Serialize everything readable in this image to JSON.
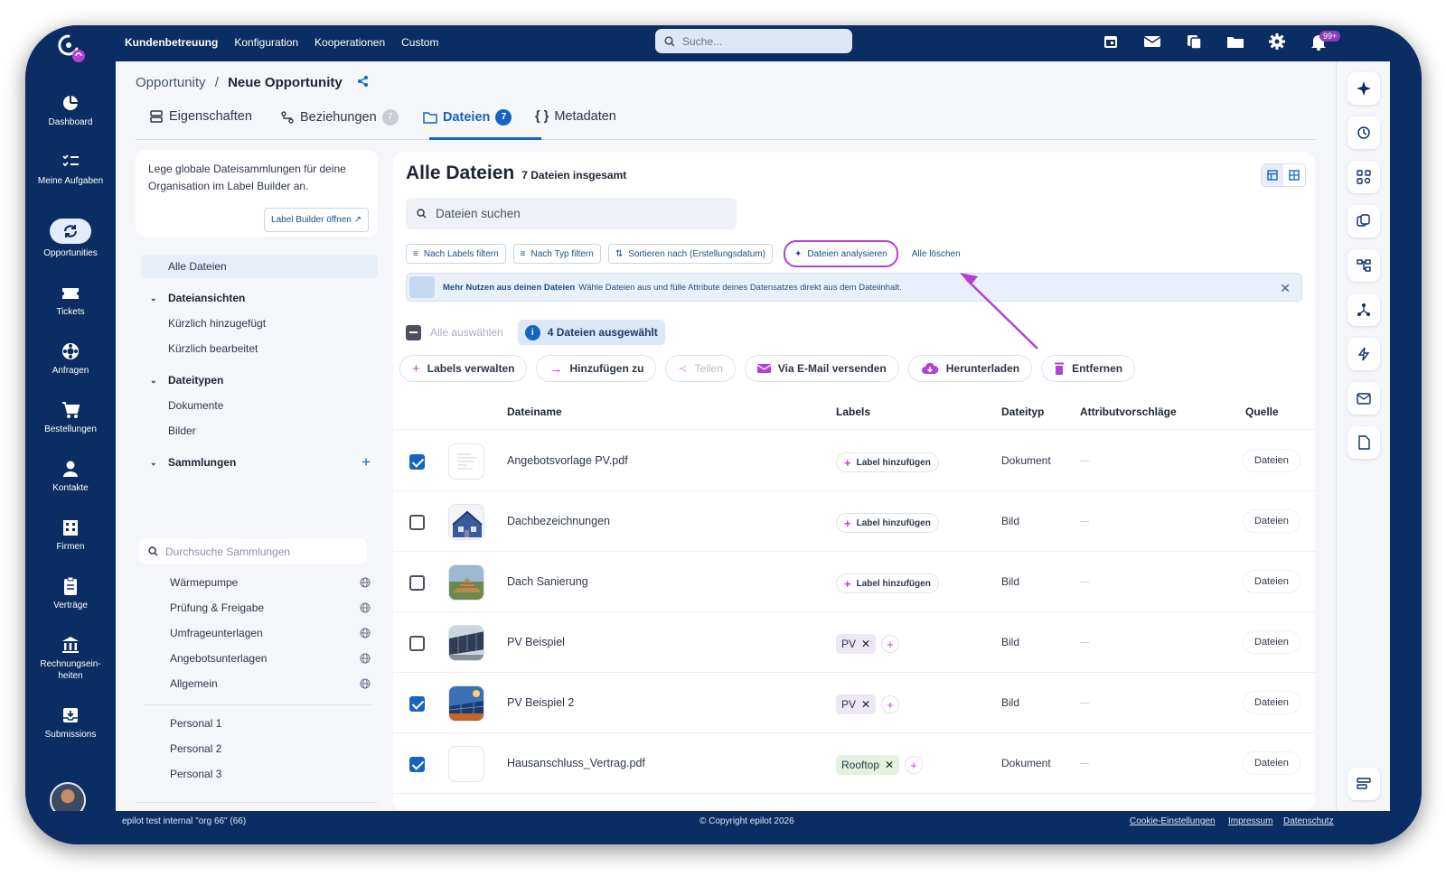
{
  "topbar": {
    "nav": [
      "Kundenbetreuung",
      "Konfiguration",
      "Kooperationen",
      "Custom"
    ],
    "search_placeholder": "Suche...",
    "notification_badge": "99+"
  },
  "sidenav": [
    {
      "label": "Dashboard",
      "icon": "dashboard-icon"
    },
    {
      "label": "Meine Aufgaben",
      "icon": "tasks-icon"
    },
    {
      "label": "Opportunities",
      "icon": "opportunities-icon",
      "active": true
    },
    {
      "label": "Tickets",
      "icon": "ticket-icon"
    },
    {
      "label": "Anfragen",
      "icon": "inquiries-icon"
    },
    {
      "label": "Bestellungen",
      "icon": "cart-icon"
    },
    {
      "label": "Kontakte",
      "icon": "person-icon"
    },
    {
      "label": "Firmen",
      "icon": "building-icon"
    },
    {
      "label": "Verträge",
      "icon": "clipboard-icon"
    },
    {
      "label": "Rechnungsein-heiten",
      "icon": "bank-icon"
    },
    {
      "label": "Submissions",
      "icon": "inbox-icon"
    }
  ],
  "breadcrumb": {
    "parent": "Opportunity",
    "separator": "/",
    "current": "Neue Opportunity"
  },
  "tabs": [
    {
      "label": "Eigenschaften",
      "count": ""
    },
    {
      "label": "Beziehungen",
      "count": "7"
    },
    {
      "label": "Dateien",
      "count": "7",
      "active": true
    },
    {
      "label": "Metadaten",
      "count": ""
    }
  ],
  "leftpanel": {
    "info_text": "Lege globale Dateisammlungen für deine Organisation im Label Builder an.",
    "label_builder_button": "Label Builder öffnen",
    "all_files": "Alle Dateien",
    "views_header": "Dateiansichten",
    "views": [
      "Kürzlich hinzugefügt",
      "Kürzlich bearbeitet"
    ],
    "types_header": "Dateitypen",
    "types": [
      "Dokumente",
      "Bilder"
    ],
    "collections_header": "Sammlungen",
    "collections_search_placeholder": "Durchsuche Sammlungen",
    "collections": [
      "Wärmepumpe",
      "Prüfung & Freigabe",
      "Umfrageunterlagen",
      "Angebotsunterlagen",
      "Allgemein"
    ],
    "personal": [
      "Personal 1",
      "Personal 2",
      "Personal 3"
    ]
  },
  "main": {
    "title": "Alle Dateien",
    "subtitle": "7 Dateien insgesamt",
    "search_placeholder": "Dateien suchen",
    "filters": [
      "Nach Labels filtern",
      "Nach Typ filtern",
      "Sortieren nach (Erstellungsdatum)",
      "Dateien analysieren",
      "Alle löschen"
    ],
    "banner_bold": "Mehr Nutzen aus deinen Dateien",
    "banner_text": "Wähle Dateien aus und fülle Attribute deines Datensatzes direkt aus dem Dateiinhalt.",
    "select_all": "Alle auswählen",
    "selected": "4 Dateien ausgewählt",
    "actions": [
      "Labels verwalten",
      "Hinzufügen zu",
      "Teilen",
      "Via E-Mail versenden",
      "Herunterladen",
      "Entfernen"
    ],
    "columns": [
      "Dateiname",
      "Labels",
      "Dateityp",
      "Attributvorschläge",
      "Quelle"
    ],
    "add_label": "Label hinzufügen",
    "rows": [
      {
        "checked": true,
        "name": "Angebotsvorlage PV.pdf",
        "labels": [],
        "type": "Dokument",
        "source": "Dateien",
        "thumb": "doc"
      },
      {
        "checked": false,
        "name": "Dachbezeichnungen",
        "labels": [],
        "type": "Bild",
        "source": "Dateien",
        "thumb": "house"
      },
      {
        "checked": false,
        "name": "Dach Sanierung",
        "labels": [],
        "type": "Bild",
        "source": "Dateien",
        "thumb": "roof"
      },
      {
        "checked": false,
        "name": "PV Beispiel",
        "labels": [
          "PV"
        ],
        "type": "Bild",
        "source": "Dateien",
        "thumb": "pv"
      },
      {
        "checked": true,
        "name": "PV Beispiel 2",
        "labels": [
          "PV"
        ],
        "type": "Bild",
        "source": "Dateien",
        "thumb": "pv2"
      },
      {
        "checked": true,
        "name": "Hausanschluss_Vertrag.pdf",
        "labels": [
          "Rooftop"
        ],
        "type": "Dokument",
        "source": "Dateien",
        "thumb": "blank"
      }
    ]
  },
  "footer": {
    "left": "epilot test internal \"org 66\" (66)",
    "center": "© Copyright epilot 2026",
    "links": [
      "Cookie-Einstellungen",
      "Impressum",
      "Datenschutz"
    ]
  },
  "colors": {
    "navy": "#0b2d63",
    "accent": "#1565c0",
    "highlight": "#b340d6"
  }
}
